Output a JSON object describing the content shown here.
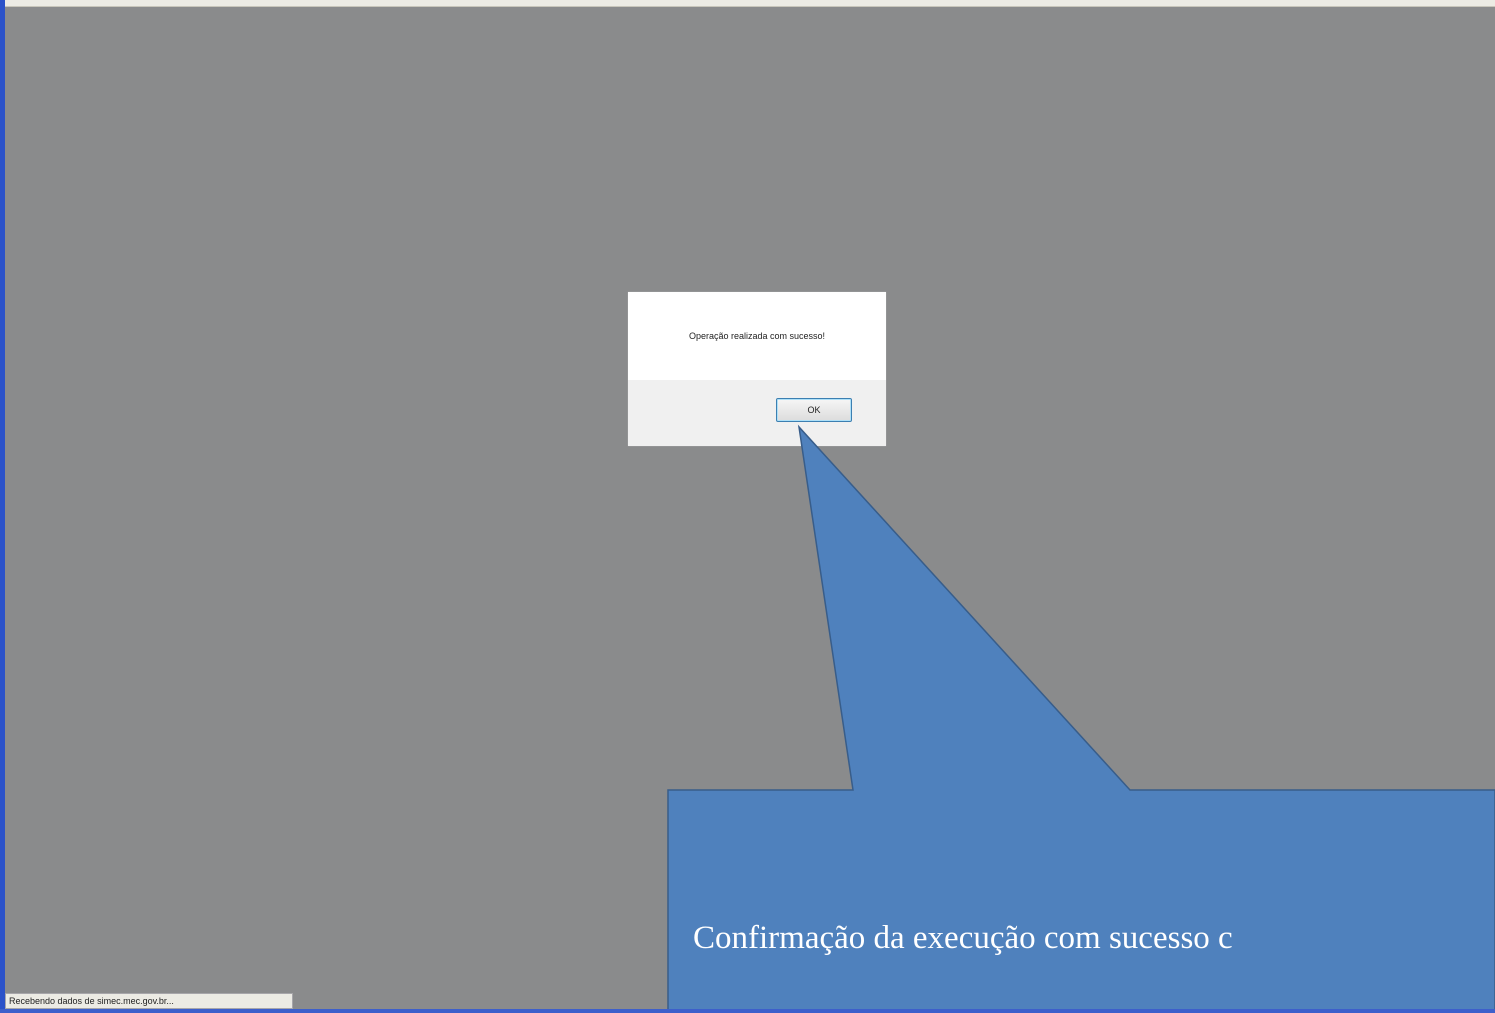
{
  "dialog": {
    "message": "Operação realizada com sucesso!",
    "ok_label": "OK"
  },
  "callout": {
    "text": "Confirmação da execução com sucesso c",
    "fill_color": "#4f81bd",
    "stroke_color": "#385d8a"
  },
  "status_bar": {
    "text": "Recebendo dados de simec.mec.gov.br..."
  },
  "colors": {
    "overlay": "#8a8b8c",
    "window_border": "#2b52c9"
  }
}
